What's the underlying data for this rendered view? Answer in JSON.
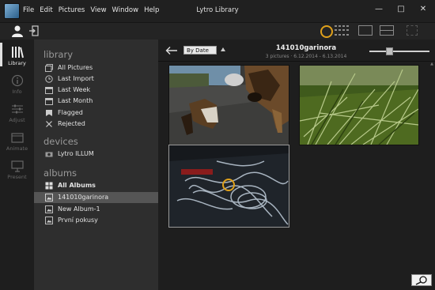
{
  "window": {
    "title": "Lytro Library",
    "menu": [
      "File",
      "Edit",
      "Pictures",
      "View",
      "Window",
      "Help"
    ],
    "controls": [
      "minimize-icon",
      "maximize-icon",
      "close-icon"
    ]
  },
  "toolbar": {
    "icons": [
      "user-icon",
      "logout-icon",
      "focus-ring-icon",
      "grid-view-icon",
      "single-view-icon",
      "split-view-icon",
      "fullscreen-icon"
    ],
    "accent_color": "#e0a11b"
  },
  "rail": {
    "items": [
      {
        "label": "Library",
        "active": true
      },
      {
        "label": "Info"
      },
      {
        "label": "Adjust"
      },
      {
        "label": "Animate"
      },
      {
        "label": "Present"
      }
    ]
  },
  "sidebar": {
    "library_title": "library",
    "library_items": [
      "All Pictures",
      "Last Import",
      "Last Week",
      "Last Month",
      "Flagged",
      "Rejected"
    ],
    "devices_title": "devices",
    "devices_items": [
      "Lytro ILLUM"
    ],
    "albums_title": "albums",
    "albums_items": [
      "All Albums",
      "141010garinora",
      "New Album-1",
      "První pokusy"
    ]
  },
  "main": {
    "sort_value": "By Date",
    "album_name": "141010garinora",
    "album_info": "3 pictures · 6.12.2014 - 6.13.2014",
    "zoom_level": 0.3
  }
}
